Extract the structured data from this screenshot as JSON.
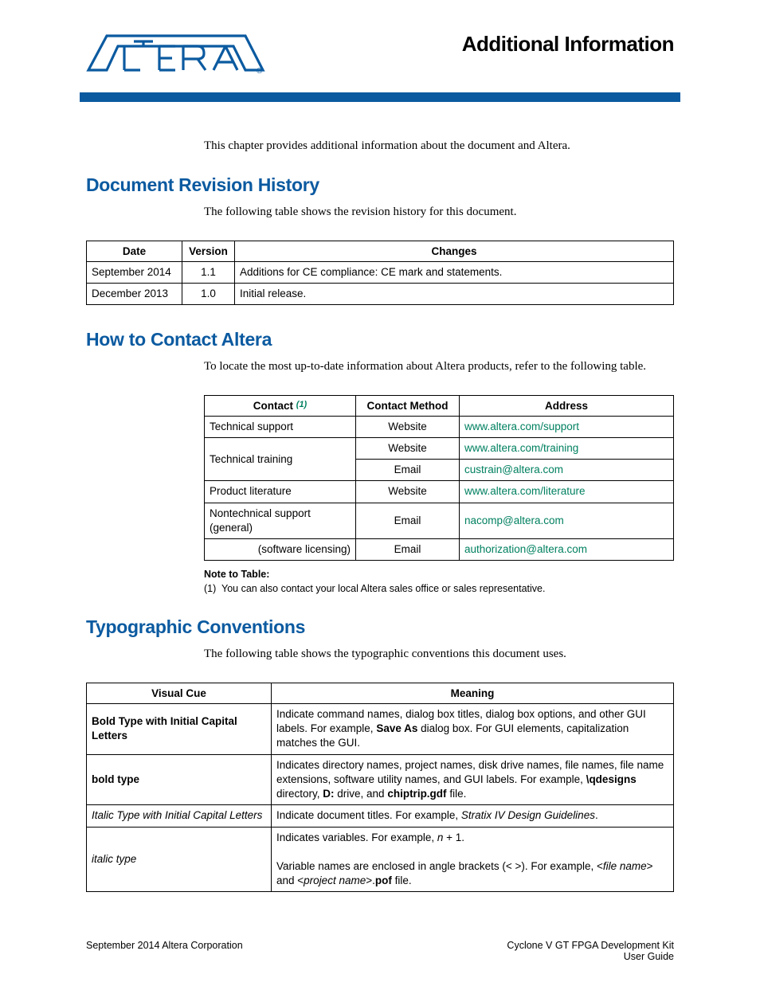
{
  "header": {
    "logo_alt": "ALTERA",
    "page_title": "Additional Information"
  },
  "intro": "This chapter provides additional information about the document and Altera.",
  "sections": {
    "revision": {
      "heading": "Document Revision History",
      "intro": "The following table shows the revision history for this document.",
      "columns": [
        "Date",
        "Version",
        "Changes"
      ],
      "rows": [
        {
          "date": "September 2014",
          "version": "1.1",
          "changes": "Additions for CE compliance: CE mark and statements."
        },
        {
          "date": "December 2013",
          "version": "1.0",
          "changes": "Initial release."
        }
      ]
    },
    "contact": {
      "heading": "How to Contact Altera",
      "intro": "To locate the most up-to-date information about Altera products, refer to the following table.",
      "columns": {
        "c1": "Contact",
        "c1_note": "(1)",
        "c2": "Contact Method",
        "c3": "Address"
      },
      "rows": [
        {
          "contact": "Technical support",
          "method": "Website",
          "address": "www.altera.com/support",
          "rowspan": 1,
          "align": "left"
        },
        {
          "contact": "Technical training",
          "method": "Website",
          "address": "www.altera.com/training",
          "rowspan": 2,
          "align": "left"
        },
        {
          "method": "Email",
          "address": "custrain@altera.com"
        },
        {
          "contact": "Product literature",
          "method": "Website",
          "address": "www.altera.com/literature",
          "rowspan": 1,
          "align": "left"
        },
        {
          "contact": "Nontechnical support (general)",
          "method": "Email",
          "address": "nacomp@altera.com",
          "rowspan": 1,
          "align": "left"
        },
        {
          "contact": "(software licensing)",
          "method": "Email",
          "address": "authorization@altera.com",
          "rowspan": 1,
          "align": "right"
        }
      ],
      "note_label": "Note to Table:",
      "note_items": [
        {
          "num": "(1)",
          "text": "You can also contact your local Altera sales office or sales representative."
        }
      ]
    },
    "typo": {
      "heading": "Typographic Conventions",
      "intro": "The following table shows the typographic conventions this document uses.",
      "columns": [
        "Visual Cue",
        "Meaning"
      ],
      "rows": [
        {
          "cue_html": "<span class=\"bold\">Bold Type with Initial Capital Letters</span>",
          "cue_plain": "Bold Type with Initial Capital Letters",
          "meaning_html": "Indicate command names, dialog box titles, dialog box options, and other GUI labels. For example, <span class=\"bold\">Save As</span> dialog box. For GUI elements, capitalization matches the GUI.",
          "meaning_plain": "Indicate command names, dialog box titles, dialog box options, and other GUI labels. For example, Save As dialog box. For GUI elements, capitalization matches the GUI."
        },
        {
          "cue_html": "<span class=\"bold\">bold type</span>",
          "cue_plain": "bold type",
          "meaning_html": "Indicates directory names, project names, disk drive names, file names, file name extensions, software utility names, and GUI labels. For example, <span class=\"bold\">\\qdesigns</span> directory, <span class=\"bold\">D:</span> drive, and <span class=\"bold\">chiptrip.gdf</span> file.",
          "meaning_plain": "Indicates directory names, project names, disk drive names, file names, file name extensions, software utility names, and GUI labels. For example, \\qdesigns directory, D: drive, and chiptrip.gdf file."
        },
        {
          "cue_html": "<span class=\"italic\">Italic Type with Initial Capital Letters</span>",
          "cue_plain": "Italic Type with Initial Capital Letters",
          "meaning_html": "Indicate document titles. For example, <span class=\"italic\">Stratix IV Design Guidelines</span>.",
          "meaning_plain": "Indicate document titles. For example, Stratix IV Design Guidelines."
        },
        {
          "cue_html": "<span class=\"italic\">italic type</span>",
          "cue_plain": "italic type",
          "meaning_html": "Indicates variables. For example, <span class=\"italic\">n</span> + 1.<br><br>Variable names are enclosed in angle brackets (&lt; &gt;). For example, &lt;<span class=\"italic\">file name</span>&gt; and &lt;<span class=\"italic\">project name</span>&gt;.<span class=\"bold\">pof</span> file.",
          "meaning_plain": "Indicates variables. For example, n + 1. Variable names are enclosed in angle brackets (< >). For example, <file name> and <project name>.pof file."
        }
      ]
    }
  },
  "footer": {
    "left": "September 2014   Altera Corporation",
    "right_line1": "Cyclone V GT FPGA Development Kit",
    "right_line2": "User Guide"
  }
}
